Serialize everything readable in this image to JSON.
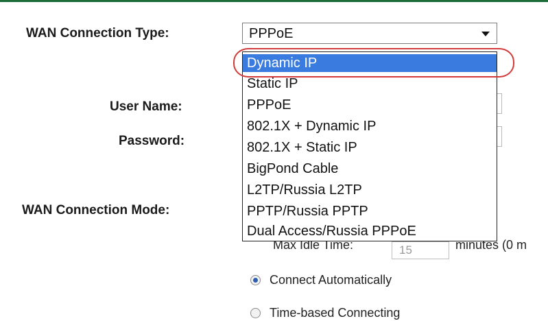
{
  "form": {
    "wan_type_label": "WAN Connection Type:",
    "user_name_label": "User Name:",
    "password_label": "Password:",
    "wan_mode_label": "WAN Connection Mode:"
  },
  "select": {
    "current_value": "PPPoE",
    "options": [
      {
        "label": "Dynamic IP",
        "selected": true
      },
      {
        "label": "Static IP",
        "selected": false
      },
      {
        "label": "PPPoE",
        "selected": false
      },
      {
        "label": "802.1X + Dynamic IP",
        "selected": false
      },
      {
        "label": "802.1X + Static IP",
        "selected": false
      },
      {
        "label": "BigPond Cable",
        "selected": false
      },
      {
        "label": "L2TP/Russia L2TP",
        "selected": false
      },
      {
        "label": "PPTP/Russia PPTP",
        "selected": false
      },
      {
        "label": "Dual Access/Russia PPPoE",
        "selected": false
      }
    ]
  },
  "idle": {
    "label": "Max Idle Time:",
    "value": "15",
    "unit": "minutes (0 m"
  },
  "mode": {
    "options": [
      {
        "label": "Connect Automatically",
        "checked": true
      },
      {
        "label": "Time-based Connecting",
        "checked": false
      }
    ]
  },
  "colors": {
    "accent_rule": "#1e6b3a",
    "selected_option": "#3a7be0",
    "annotation_oval": "#d23a3a"
  }
}
